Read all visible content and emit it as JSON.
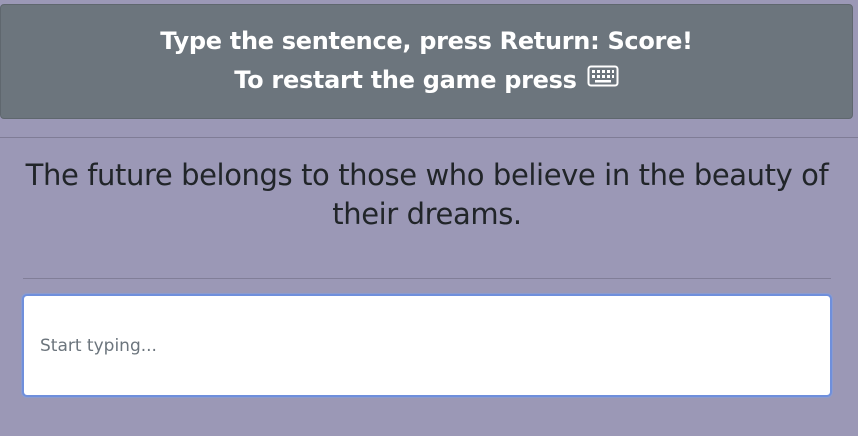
{
  "header": {
    "line1": "Type the sentence, press Return: Score!",
    "line2": "To restart the game press",
    "restart_icon": "keyboard-icon"
  },
  "quote": {
    "text": "The future belongs to those who believe in the beauty of their dreams."
  },
  "typing_input": {
    "value": "",
    "placeholder": "Start typing..."
  },
  "colors": {
    "background": "#9b98b6",
    "header_background": "#6c757d",
    "input_focus_border": "#6f8fdc"
  }
}
